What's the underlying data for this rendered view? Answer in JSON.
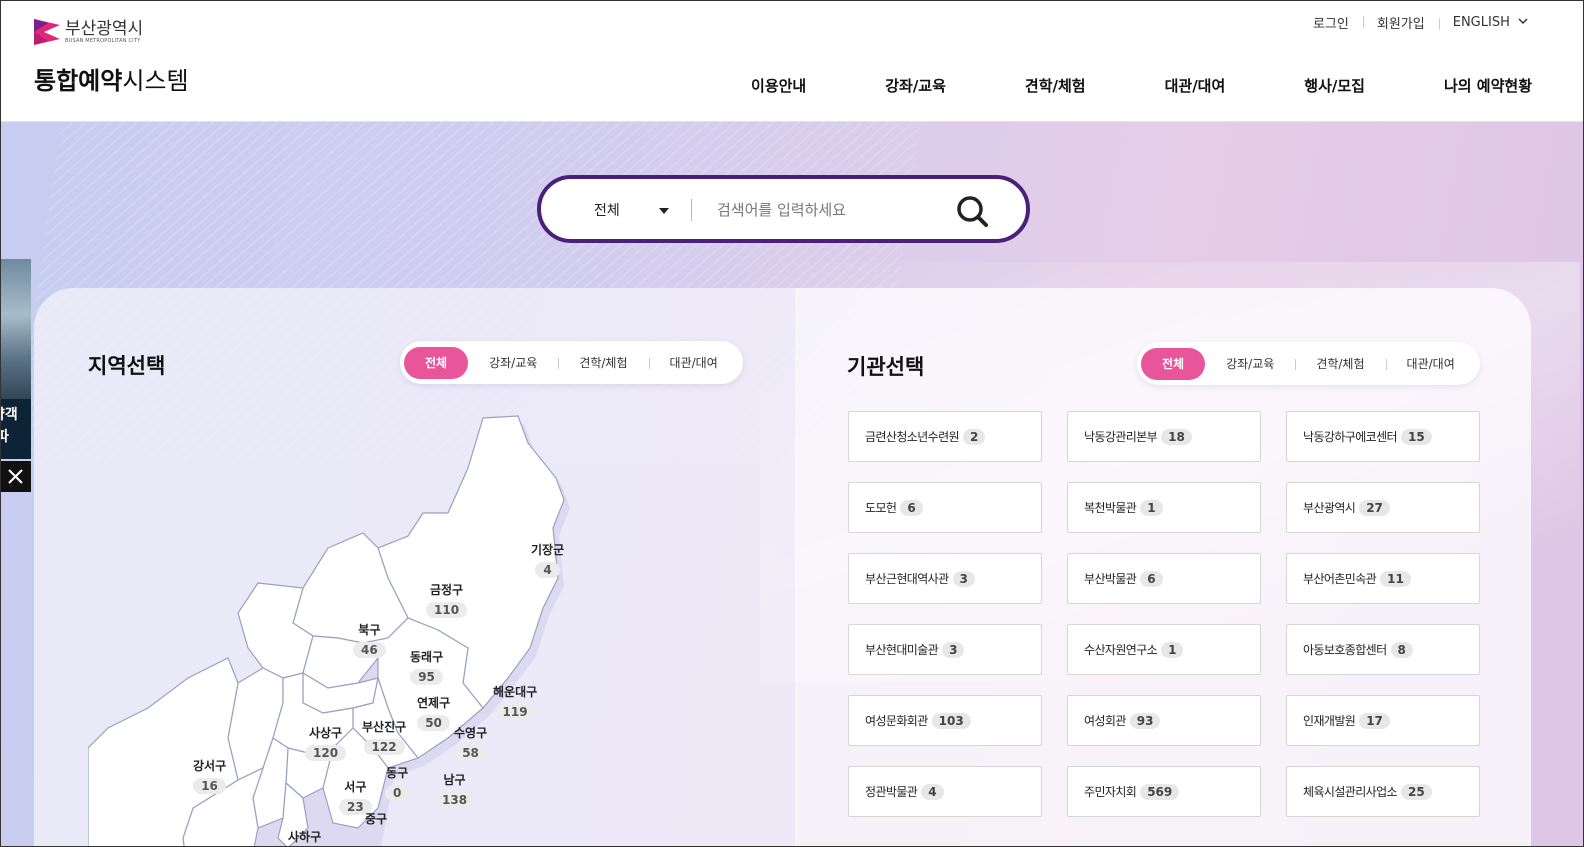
{
  "header": {
    "logo_name": "부산광역시",
    "logo_sub": "BUSAN METROPOLITAN CITY",
    "title_bold": "통합예약",
    "title_rest": "시스템",
    "util": {
      "login": "로그인",
      "join": "회원가입",
      "lang": "ENGLISH"
    },
    "nav": [
      "이용안내",
      "강좌/교육",
      "견학/체험",
      "대관/대여",
      "행사/모집",
      "나의 예약현황"
    ]
  },
  "search": {
    "category": "전체",
    "placeholder": "검색어를 입력하세요"
  },
  "side_banner": {
    "line1": "약객",
    "line2": "파"
  },
  "region": {
    "title": "지역선택",
    "tabs": [
      "전체",
      "강좌/교육",
      "견학/체험",
      "대관/대여"
    ],
    "districts": [
      {
        "name": "기장군",
        "count": "4"
      },
      {
        "name": "금정구",
        "count": "110"
      },
      {
        "name": "북구",
        "count": "46"
      },
      {
        "name": "동래구",
        "count": "95"
      },
      {
        "name": "해운대구",
        "count": "119"
      },
      {
        "name": "연제구",
        "count": "50"
      },
      {
        "name": "사상구",
        "count": "120"
      },
      {
        "name": "부산진구",
        "count": "122"
      },
      {
        "name": "수영구",
        "count": "58"
      },
      {
        "name": "강서구",
        "count": "16"
      },
      {
        "name": "서구",
        "count": "23"
      },
      {
        "name": "동구",
        "count": "0"
      },
      {
        "name": "남구",
        "count": "138"
      },
      {
        "name": "중구",
        "count": ""
      },
      {
        "name": "사하구",
        "count": ""
      }
    ]
  },
  "org": {
    "title": "기관선택",
    "tabs": [
      "전체",
      "강좌/교육",
      "견학/체험",
      "대관/대여"
    ],
    "items": [
      {
        "name": "금련산청소년수련원",
        "count": "2"
      },
      {
        "name": "낙동강관리본부",
        "count": "18"
      },
      {
        "name": "낙동강하구에코센터",
        "count": "15"
      },
      {
        "name": "도모헌",
        "count": "6"
      },
      {
        "name": "복천박물관",
        "count": "1"
      },
      {
        "name": "부산광역시",
        "count": "27"
      },
      {
        "name": "부산근현대역사관",
        "count": "3"
      },
      {
        "name": "부산박물관",
        "count": "6"
      },
      {
        "name": "부산어촌민속관",
        "count": "11"
      },
      {
        "name": "부산현대미술관",
        "count": "3"
      },
      {
        "name": "수산자원연구소",
        "count": "1"
      },
      {
        "name": "아동보호종합센터",
        "count": "8"
      },
      {
        "name": "여성문화회관",
        "count": "103"
      },
      {
        "name": "여성회관",
        "count": "93"
      },
      {
        "name": "인재개발원",
        "count": "17"
      },
      {
        "name": "정관박물관",
        "count": "4"
      },
      {
        "name": "주민자치회",
        "count": "569"
      },
      {
        "name": "체육시설관리사업소",
        "count": "25"
      }
    ]
  },
  "colors": {
    "accent": "#e8559a",
    "search_border": "#4b1f7a"
  }
}
